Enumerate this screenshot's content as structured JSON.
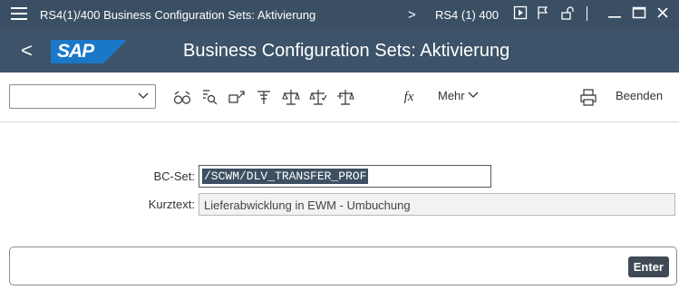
{
  "titlebar": {
    "window_title": "RS4(1)/400 Business Configuration Sets: Aktivierung",
    "arrow": ">",
    "system": "RS4 (1) 400"
  },
  "header": {
    "title": "Business Configuration Sets: Aktivierung",
    "logo_text": "SAP",
    "back_glyph": "<"
  },
  "toolbar": {
    "dropdown_value": "",
    "fx_label": "fx",
    "mehr_label": "Mehr",
    "beenden_label": "Beenden"
  },
  "form": {
    "bcset_label": "BC-Set:",
    "bcset_value": "/SCWM/DLV_TRANSFER_PROF",
    "kurztext_label": "Kurztext:",
    "kurztext_value": "Lieferabwicklung in EWM - Umbuchung"
  },
  "footer": {
    "enter_label": "Enter"
  },
  "colors": {
    "titlebar": "#3a4f63",
    "header": "#3c5369",
    "logo_blue": "#1b78c8",
    "selection": "#3d4f61"
  }
}
